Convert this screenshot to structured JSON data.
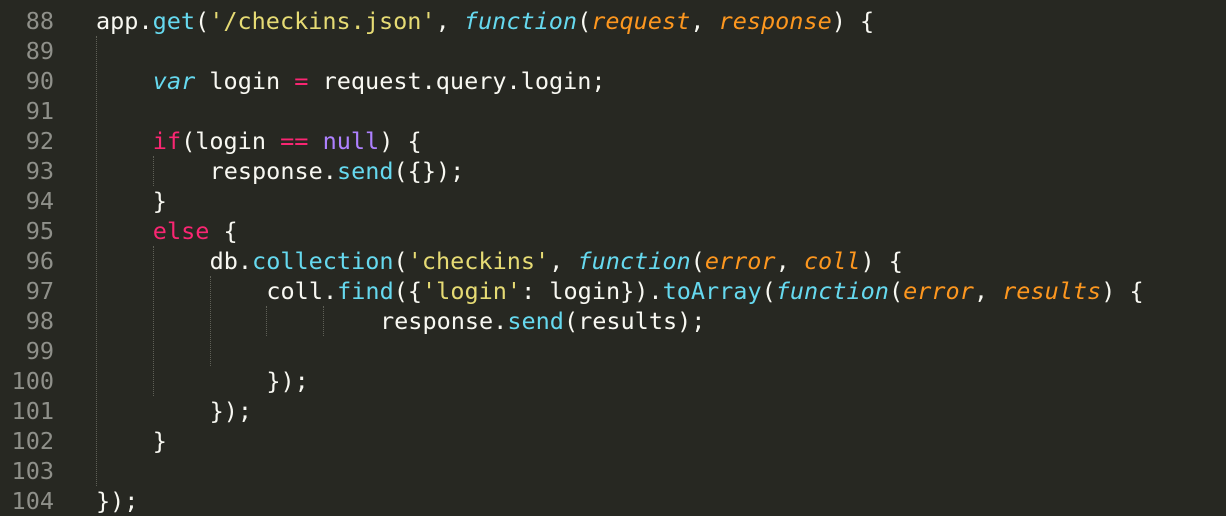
{
  "editor": {
    "lines": [
      {
        "number": "88",
        "indent": "",
        "tokens": [
          {
            "t": "app.",
            "c": "plain"
          },
          {
            "t": "get",
            "c": "fn"
          },
          {
            "t": "(",
            "c": "plain"
          },
          {
            "t": "'/checkins.json'",
            "c": "str"
          },
          {
            "t": ", ",
            "c": "plain"
          },
          {
            "t": "function",
            "c": "sto"
          },
          {
            "t": "(",
            "c": "plain"
          },
          {
            "t": "request",
            "c": "param"
          },
          {
            "t": ", ",
            "c": "plain"
          },
          {
            "t": "response",
            "c": "param"
          },
          {
            "t": ") {",
            "c": "plain"
          }
        ]
      },
      {
        "number": "89",
        "indent": "",
        "tokens": []
      },
      {
        "number": "90",
        "indent": "    ",
        "tokens": [
          {
            "t": "var",
            "c": "sto"
          },
          {
            "t": " login ",
            "c": "plain"
          },
          {
            "t": "=",
            "c": "kw"
          },
          {
            "t": " request.query.login;",
            "c": "plain"
          }
        ]
      },
      {
        "number": "91",
        "indent": "",
        "tokens": []
      },
      {
        "number": "92",
        "indent": "    ",
        "tokens": [
          {
            "t": "if",
            "c": "kw"
          },
          {
            "t": "(login ",
            "c": "plain"
          },
          {
            "t": "==",
            "c": "kw"
          },
          {
            "t": " ",
            "c": "plain"
          },
          {
            "t": "null",
            "c": "const"
          },
          {
            "t": ") {",
            "c": "plain"
          }
        ]
      },
      {
        "number": "93",
        "indent": "        ",
        "tokens": [
          {
            "t": "response.",
            "c": "plain"
          },
          {
            "t": "send",
            "c": "fn"
          },
          {
            "t": "({});",
            "c": "plain"
          }
        ]
      },
      {
        "number": "94",
        "indent": "    ",
        "tokens": [
          {
            "t": "}",
            "c": "plain"
          }
        ]
      },
      {
        "number": "95",
        "indent": "    ",
        "tokens": [
          {
            "t": "else",
            "c": "kw"
          },
          {
            "t": " {",
            "c": "plain"
          }
        ]
      },
      {
        "number": "96",
        "indent": "        ",
        "tokens": [
          {
            "t": "db.",
            "c": "plain"
          },
          {
            "t": "collection",
            "c": "fn"
          },
          {
            "t": "(",
            "c": "plain"
          },
          {
            "t": "'checkins'",
            "c": "str"
          },
          {
            "t": ", ",
            "c": "plain"
          },
          {
            "t": "function",
            "c": "sto"
          },
          {
            "t": "(",
            "c": "plain"
          },
          {
            "t": "error",
            "c": "param"
          },
          {
            "t": ", ",
            "c": "plain"
          },
          {
            "t": "coll",
            "c": "param"
          },
          {
            "t": ") {",
            "c": "plain"
          }
        ]
      },
      {
        "number": "97",
        "indent": "            ",
        "tokens": [
          {
            "t": "coll.",
            "c": "plain"
          },
          {
            "t": "find",
            "c": "fn"
          },
          {
            "t": "({",
            "c": "plain"
          },
          {
            "t": "'login'",
            "c": "str"
          },
          {
            "t": ": login}).",
            "c": "plain"
          },
          {
            "t": "toArray",
            "c": "fn"
          },
          {
            "t": "(",
            "c": "plain"
          },
          {
            "t": "function",
            "c": "sto"
          },
          {
            "t": "(",
            "c": "plain"
          },
          {
            "t": "error",
            "c": "param"
          },
          {
            "t": ", ",
            "c": "plain"
          },
          {
            "t": "results",
            "c": "param"
          },
          {
            "t": ") {",
            "c": "plain"
          }
        ]
      },
      {
        "number": "98",
        "indent": "                    ",
        "tokens": [
          {
            "t": "response.",
            "c": "plain"
          },
          {
            "t": "send",
            "c": "fn"
          },
          {
            "t": "(results);",
            "c": "plain"
          }
        ]
      },
      {
        "number": "99",
        "indent": "",
        "tokens": []
      },
      {
        "number": "100",
        "indent": "            ",
        "tokens": [
          {
            "t": "});",
            "c": "plain"
          }
        ]
      },
      {
        "number": "101",
        "indent": "        ",
        "tokens": [
          {
            "t": "});",
            "c": "plain"
          }
        ]
      },
      {
        "number": "102",
        "indent": "    ",
        "tokens": [
          {
            "t": "}",
            "c": "plain"
          }
        ]
      },
      {
        "number": "103",
        "indent": "",
        "tokens": []
      },
      {
        "number": "104",
        "indent": "",
        "tokens": [
          {
            "t": "});",
            "c": "plain"
          }
        ]
      }
    ]
  }
}
